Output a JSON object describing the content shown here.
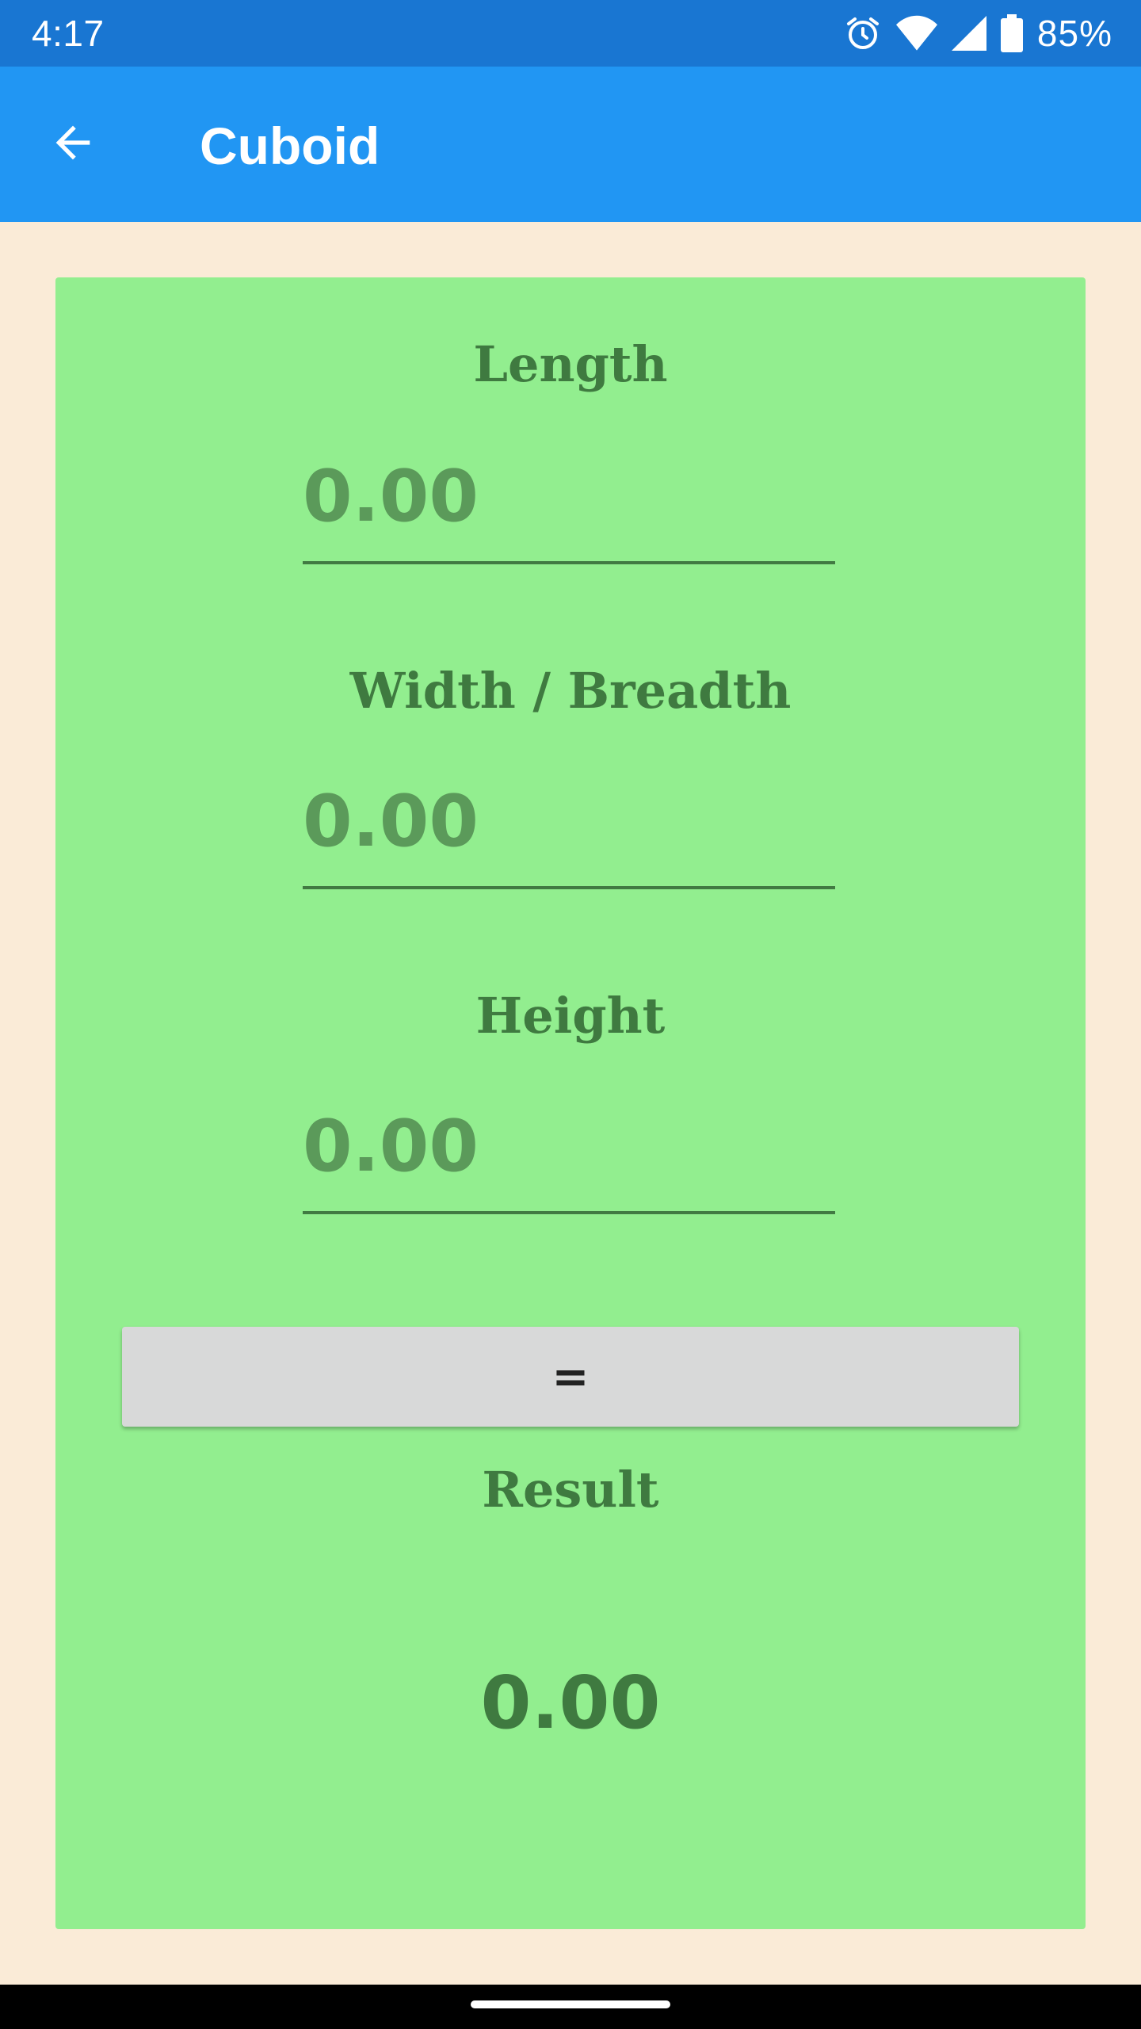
{
  "status_bar": {
    "time": "4:17",
    "battery_percent": "85%",
    "icons": [
      "alarm-icon",
      "wifi-icon",
      "cell-signal-icon",
      "battery-icon"
    ]
  },
  "app_bar": {
    "title": "Cuboid",
    "back_icon": "arrow-back-icon",
    "background_color": "#2196f3"
  },
  "form": {
    "length": {
      "label": "Length",
      "placeholder": "0.00",
      "value": ""
    },
    "width": {
      "label": "Width / Breadth",
      "placeholder": "0.00",
      "value": ""
    },
    "height": {
      "label": "Height",
      "placeholder": "0.00",
      "value": ""
    },
    "calculate_button_label": "=",
    "result_label": "Result",
    "result_value": "0.00"
  },
  "colors": {
    "page_background": "#faebd7",
    "card_background": "#92ee8f",
    "text_color": "#3f7a40",
    "status_bar": "#1976d2"
  }
}
